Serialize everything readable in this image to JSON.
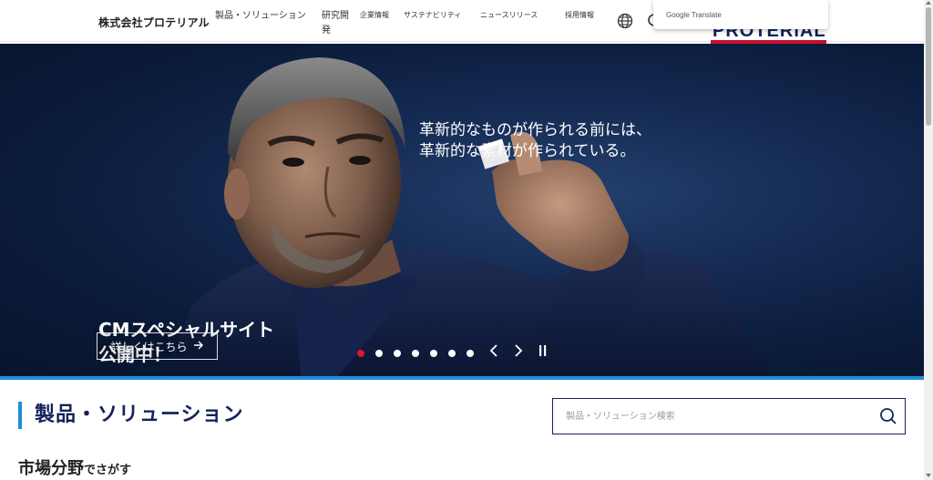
{
  "header": {
    "company_name": "株式会社プロテリアル",
    "nav": [
      {
        "label": "製品・ソリューション"
      },
      {
        "label": "研究開発"
      },
      {
        "label": "企業情報"
      },
      {
        "label": "サステナビリティ"
      },
      {
        "label": "ニュースリリース"
      },
      {
        "label": "採用情報"
      }
    ],
    "logo_text": "PROTERIAL",
    "google_translate_label": "Google Translate"
  },
  "hero": {
    "tagline_line1": "革新的なものが作られる前には、",
    "tagline_line2": "革新的な素材が作られている。",
    "cm_line1": "CMスペシャルサイト",
    "cm_line2": "公開中！",
    "more_button": "詳しくはこちら",
    "slide_count": 7,
    "active_slide": 1
  },
  "products": {
    "title": "製品・ソリューション",
    "search_placeholder": "製品・ソリューション検索",
    "market_heading": "市場分野",
    "market_heading_suffix": "でさがす"
  },
  "colors": {
    "brand_navy": "#13235a",
    "accent_blue": "#1f8fd6",
    "active_dot": "#e0162b"
  }
}
